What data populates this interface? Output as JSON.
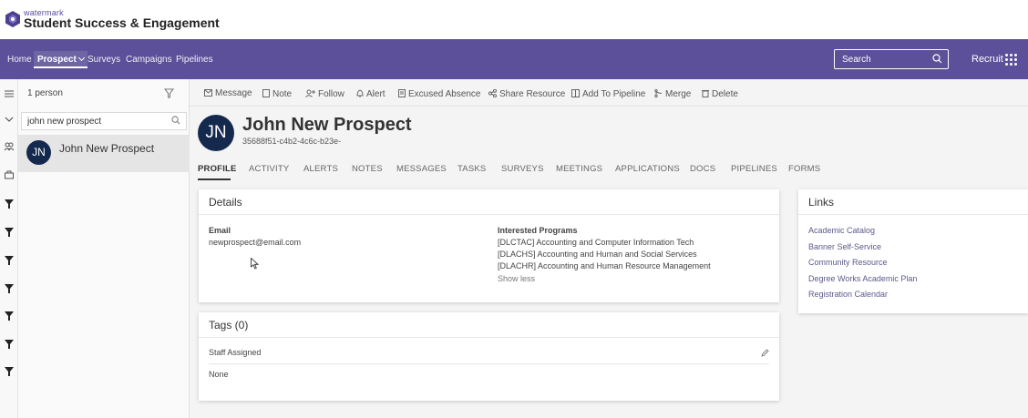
{
  "header": {
    "brand_small": "watermark",
    "brand_title": "Student Success & Engagement"
  },
  "nav": {
    "home": "Home",
    "prospect": "Prospect",
    "surveys": "Surveys",
    "campaigns": "Campaigns",
    "pipelines": "Pipelines",
    "search_placeholder": "Search",
    "recruit": "Recruit",
    "colors": {
      "nav_bg": "#5b5099",
      "avatar_bg": "#14294d"
    }
  },
  "results": {
    "count": "1 person",
    "search_value": "john new prospect",
    "person_initials": "JN",
    "person_name": "John New Prospect"
  },
  "toolbar": {
    "message": "Message",
    "note": "Note",
    "follow": "Follow",
    "alert": "Alert",
    "excused_absence": "Excused Absence",
    "share_resource": "Share Resource",
    "add_to_pipeline": "Add To Pipeline",
    "merge": "Merge",
    "delete": "Delete"
  },
  "profile": {
    "initials": "JN",
    "name": "John New Prospect",
    "id": "35688f51-c4b2-4c6c-b23e-"
  },
  "tabs": [
    "PROFILE",
    "ACTIVITY",
    "ALERTS",
    "NOTES",
    "MESSAGES",
    "TASKS",
    "SURVEYS",
    "MEETINGS",
    "APPLICATIONS",
    "DOCS",
    "PIPELINES",
    "FORMS"
  ],
  "details": {
    "title": "Details",
    "email_label": "Email",
    "email_value": "newprospect@email.com",
    "programs_label": "Interested Programs",
    "programs": [
      "[DLCTAC] Accounting and Computer Information Tech",
      "[DLACHS] Accounting and Human and Social Services",
      "[DLACHR] Accounting and Human Resource Management"
    ],
    "show_less": "Show less"
  },
  "tags": {
    "title": "Tags (0)",
    "staff_label": "Staff Assigned",
    "staff_value": "None"
  },
  "links": {
    "title": "Links",
    "items": [
      "Academic Catalog",
      "Banner Self-Service",
      "Community Resource",
      "Degree Works Academic Plan",
      "Registration Calendar"
    ]
  }
}
